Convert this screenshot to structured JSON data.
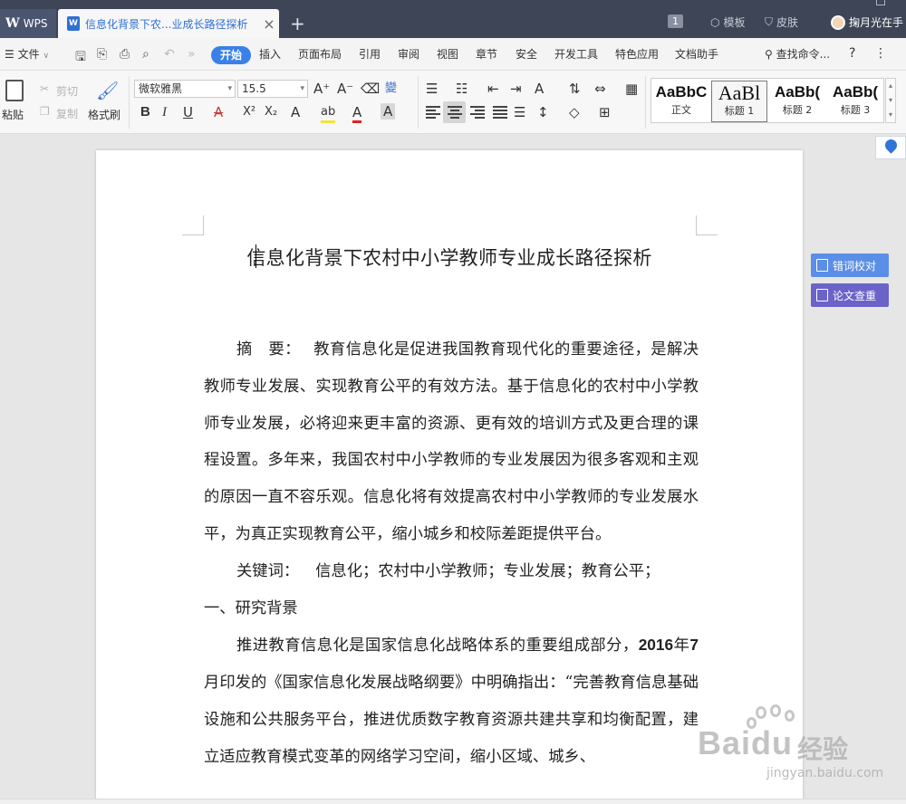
{
  "app": {
    "name": "WPS",
    "tab_title": "信息化背景下农...业成长路径探析",
    "tab_close": "×",
    "new_tab": "+",
    "page_badge": "1",
    "templates": "模板",
    "skin": "皮肤",
    "user": "掬月光在手"
  },
  "menu": {
    "file": "文件",
    "tabs": [
      "开始",
      "插入",
      "页面布局",
      "引用",
      "审阅",
      "视图",
      "章节",
      "安全",
      "开发工具",
      "特色应用",
      "文档助手"
    ],
    "search": "查找命令...",
    "help": "?",
    "more": "⋮"
  },
  "ribbon": {
    "paste": "粘贴",
    "cut": "剪切",
    "copy": "复制",
    "format_painter": "格式刷",
    "font_name": "微软雅黑",
    "font_size": "15.5",
    "bold": "B",
    "italic": "I",
    "underline": "U",
    "strikethrough": "A",
    "superscript": "X²",
    "subscript": "X₂",
    "text_effect": "A",
    "highlight": "ab",
    "font_color": "A",
    "char_shading": "A",
    "grow_font": "A⁺",
    "shrink_font": "A⁻",
    "phonetic": "變",
    "styles": [
      {
        "sample": "AaBbC",
        "name": "正文"
      },
      {
        "sample": "AaBl",
        "name": "标题 1"
      },
      {
        "sample": "AaBb(",
        "name": "标题 2"
      },
      {
        "sample": "AaBb(",
        "name": "标题 3"
      }
    ]
  },
  "side_panel": {
    "proofread": "错词校对",
    "plagiarism": "论文查重"
  },
  "document": {
    "title": "信息化背景下农村中小学教师专业成长路径探析",
    "abstract_label": "摘　要：",
    "abstract": "教育信息化是促进我国教育现代化的重要途径，是解决教师专业发展、实现教育公平的有效方法。基于信息化的农村中小学教师专业发展，必将迎来更丰富的资源、更有效的培训方式及更合理的课程设置。多年来，我国农村中小学教师的专业发展因为很多客观和主观的原因一直不容乐观。信息化将有效提高农村中小学教师的专业发展水平，为真正实现教育公平，缩小城乡和校际差距提供平台。",
    "keywords_label": "关键词：",
    "keywords": "信息化；农村中小学教师；专业发展；教育公平；",
    "section1": "一、研究背景",
    "para1_a": "推进教育信息化是国家信息化战略体系的重要组成部分，",
    "para1_year": "2016",
    "para1_b": "年",
    "para1_month": "7",
    "para1_c": "月印发的《国家信息化发展战略纲要》中明确指出：“完善教育信息基础设施和公共服务平台，推进优质数字教育资源共建共享和均衡配置，建立适应教育模式变革的网络学习空间，缩小区域、城乡、"
  },
  "watermark": {
    "brand": "Bai",
    "brand2": "du",
    "cn": "经验",
    "url": "jingyan.baidu.com"
  },
  "colors": {
    "titlebar": "#3d4557",
    "accent": "#3a80e8",
    "proofread_btn": "#5b8ee6",
    "plagiarism_btn": "#6b63c9"
  }
}
